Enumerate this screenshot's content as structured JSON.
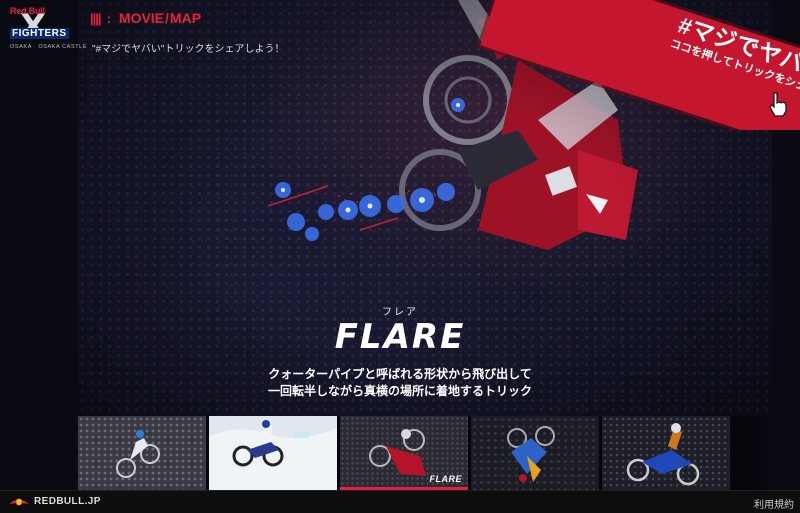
{
  "logo": {
    "brand": "Red Bull",
    "event": "FIGHTERS",
    "location": "OSAKA · OSAKA CASTLE"
  },
  "header": {
    "nav_movie": "MOVIE",
    "nav_separator": "/",
    "nav_map": "MAP",
    "subtitle": "\"#マジでヤバい\"トリックをシェアしよう！"
  },
  "badge": {
    "hashtag": "#マジでヤバい",
    "subtitle": "ココを押してトリックをシェア！",
    "cursor_icon": "hand-pointer-icon"
  },
  "trick": {
    "reading": "フレア",
    "name": "FLARE",
    "description_line1": "クォーターパイプと呼ばれる形状から飛び出して",
    "description_line2": "一回転半しながら真横の場所に着地するトリック"
  },
  "thumbnails": {
    "items": [
      {
        "label": ""
      },
      {
        "label": ""
      },
      {
        "label": "FLARE"
      },
      {
        "label": ""
      },
      {
        "label": ""
      }
    ],
    "selected_index": 2
  },
  "footer": {
    "site": "REDBULL.JP",
    "terms": "利用規約"
  },
  "colors": {
    "accent_red": "#e8213d",
    "badge_red": "#c4162e",
    "background": "#05050c"
  }
}
